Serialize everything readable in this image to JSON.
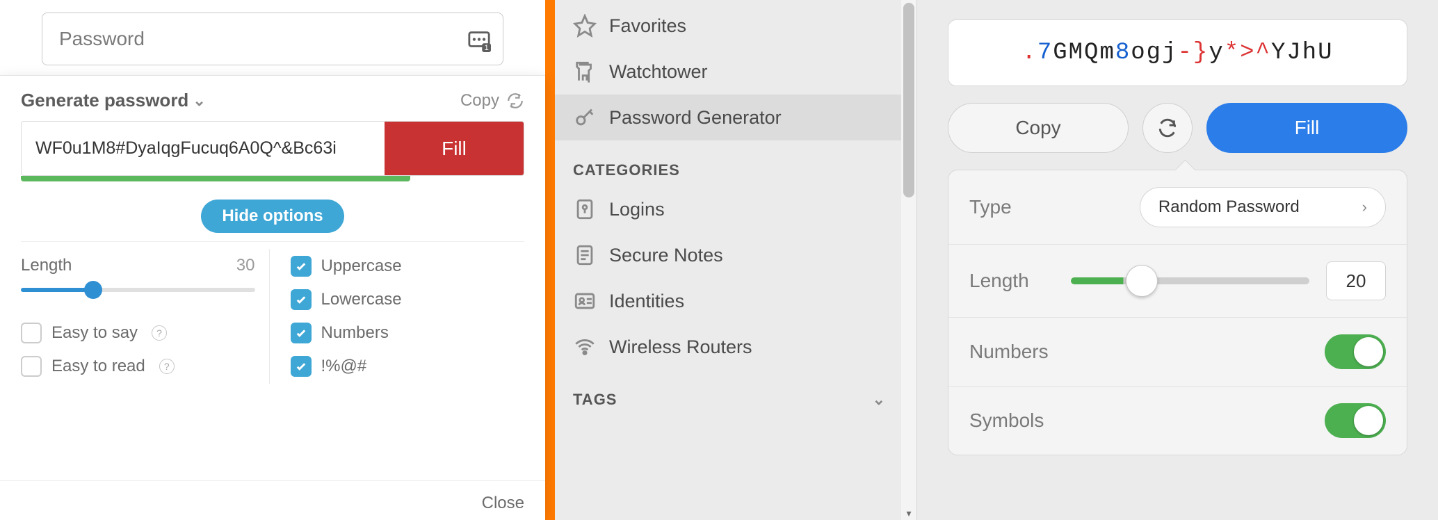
{
  "left": {
    "password_placeholder": "Password",
    "title": "Generate password",
    "copy_label": "Copy",
    "generated_password": "WF0u1M8#DyaIqgFucuq6A0Q^&Bc63i",
    "fill_label": "Fill",
    "hide_options_label": "Hide options",
    "length_label": "Length",
    "length_value": "30",
    "easy_say_label": "Easy to say",
    "easy_read_label": "Easy to read",
    "uppercase_label": "Uppercase",
    "lowercase_label": "Lowercase",
    "numbers_label": "Numbers",
    "symbols_label": "!%@#",
    "close_label": "Close"
  },
  "mid": {
    "items": [
      {
        "label": "Favorites"
      },
      {
        "label": "Watchtower"
      },
      {
        "label": "Password Generator"
      }
    ],
    "categories_header": "CATEGORIES",
    "categories": [
      {
        "label": "Logins"
      },
      {
        "label": "Secure Notes"
      },
      {
        "label": "Identities"
      },
      {
        "label": "Wireless Routers"
      }
    ],
    "tags_header": "TAGS"
  },
  "right": {
    "password_tokens": [
      {
        "t": ".",
        "c": "sym"
      },
      {
        "t": "7",
        "c": "num"
      },
      {
        "t": "GMQm",
        "c": "ltr"
      },
      {
        "t": "8",
        "c": "num"
      },
      {
        "t": "ogj",
        "c": "ltr"
      },
      {
        "t": "-}",
        "c": "sym"
      },
      {
        "t": "y",
        "c": "ltr"
      },
      {
        "t": "*>^",
        "c": "sym"
      },
      {
        "t": "YJhU",
        "c": "ltr"
      }
    ],
    "copy_label": "Copy",
    "fill_label": "Fill",
    "type_label": "Type",
    "type_value": "Random Password",
    "length_label": "Length",
    "length_value": "20",
    "numbers_label": "Numbers",
    "symbols_label": "Symbols"
  }
}
